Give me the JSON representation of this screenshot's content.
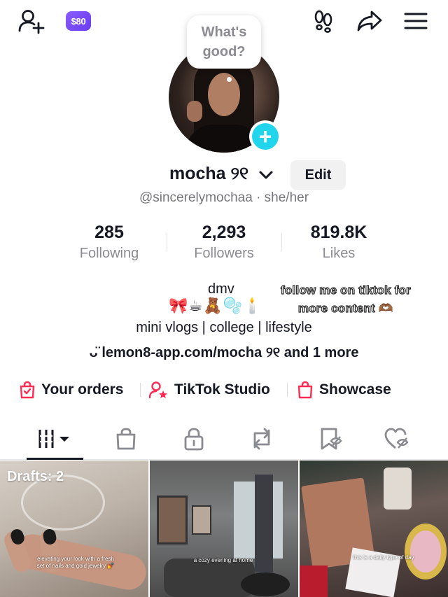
{
  "header": {
    "add_friend_icon": "person-add-icon",
    "coins_badge": "$80",
    "footprint_icon": "footprints-icon",
    "share_icon": "share-arrow-icon",
    "menu_icon": "hamburger-menu-icon"
  },
  "profile": {
    "bubble_text_line1": "What's",
    "bubble_text_line2": "good?",
    "name": "mocha ୨୧",
    "edit_label": "Edit",
    "handle_line": "@sincerelymochaa · she/her"
  },
  "stats": [
    {
      "value": "285",
      "label": "Following"
    },
    {
      "value": "2,293",
      "label": "Followers"
    },
    {
      "value": "819.8K",
      "label": "Likes"
    }
  ],
  "bio": {
    "line1": "dmv",
    "emoji_line": "🎀☕🧸🫧🕯️",
    "line3": "mini vlogs | college | lifestyle",
    "link": "ᴗ̈ lemon8-app.com/mocha ୨୧ and 1 more",
    "sticker_line1": "follow me on tiktok for",
    "sticker_line2": "more content 🫶🏾"
  },
  "shortcuts": [
    {
      "label": "Your orders",
      "icon": "order-bag-check-icon"
    },
    {
      "label": "TikTok Studio",
      "icon": "person-star-icon"
    },
    {
      "label": "Showcase",
      "icon": "showcase-bag-icon"
    }
  ],
  "tabs": [
    {
      "name": "videos-grid-icon",
      "active": true
    },
    {
      "name": "shop-bag-icon",
      "active": false
    },
    {
      "name": "private-lock-icon",
      "active": false
    },
    {
      "name": "repost-icon",
      "active": false
    },
    {
      "name": "favorites-bookmark-icon",
      "active": false
    },
    {
      "name": "liked-heart-icon",
      "active": false
    }
  ],
  "grid": {
    "drafts_label": "Drafts: 2",
    "cap1": "elevating your look with a fresh set of nails and gold jewelry 💅",
    "cap2": "a cozy evening at home",
    "cap3": "this is a daily type of day"
  },
  "colors": {
    "accent_pink": "#fe2c55",
    "follow_teal": "#20d5ec",
    "coin_purple": "#7a4cf5"
  }
}
